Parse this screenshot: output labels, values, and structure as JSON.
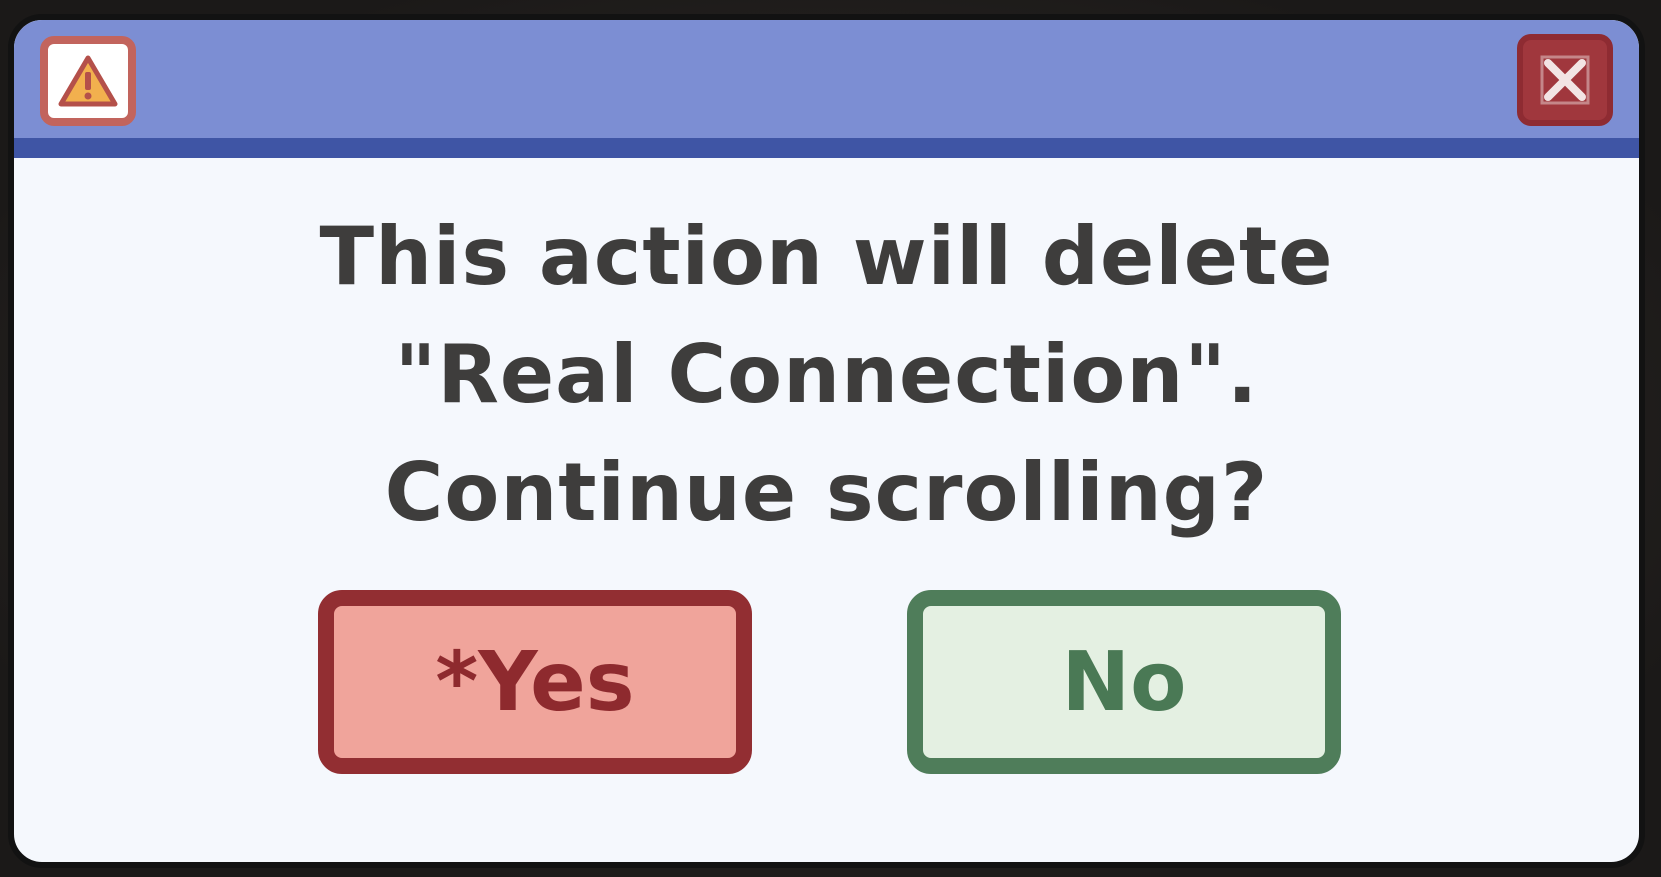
{
  "dialog": {
    "title_icon": "warning-icon",
    "close_icon": "close-icon",
    "message_lines": [
      "This action will delete",
      "\"Real Connection\".",
      "Continue scrolling?"
    ],
    "buttons": {
      "yes_label": "*Yes",
      "no_label": "No"
    }
  },
  "colors": {
    "titlebar": "#7c8ed3",
    "titlebar_border": "#3f55a5",
    "body": "#f5f8fd",
    "yes_fill": "#f0a49b",
    "yes_border": "#922e32",
    "no_fill": "#e4f0e2",
    "no_border": "#4f7d5a",
    "close": "#a0373d",
    "text": "#3e3d3c"
  }
}
